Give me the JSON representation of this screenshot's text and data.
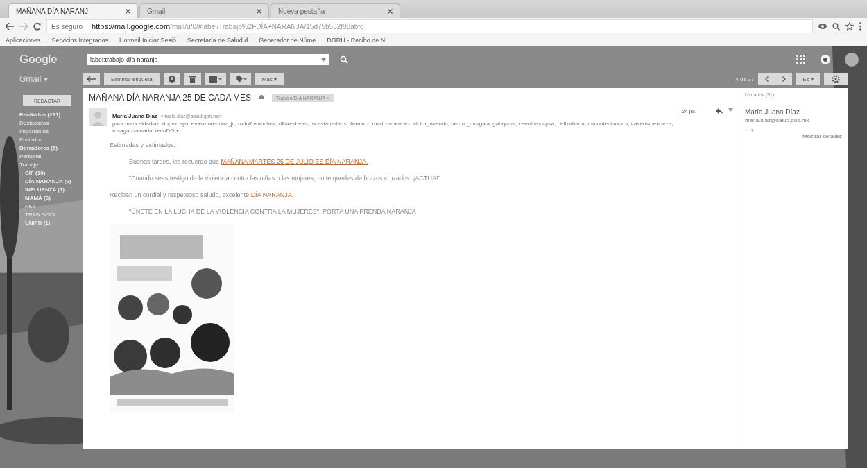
{
  "browser": {
    "tabs": [
      {
        "title": "MAÑANA DÍA NARANJ",
        "selected": true
      },
      {
        "title": "Gmail",
        "selected": false
      },
      {
        "title": "Nueva pestaña",
        "selected": false
      }
    ],
    "security": "Es seguro",
    "url_host": "https://mail.google.com",
    "url_path": "/mail/u/0/#label/Trabajo%2FDÍA+NARANJA/15d75b552f08abfc",
    "bookmarks": [
      "Aplicaciones",
      "Servicios Integrados",
      "Hotmail Iniciar Sesió",
      "Secretaría de Salud d",
      "Generador de Núme",
      "DGRH - Recibo de N"
    ]
  },
  "header": {
    "logo": "Google",
    "search": {
      "value": "label:trabajo-día-naranja"
    }
  },
  "sidebar": {
    "app": "Gmail ▾",
    "compose": "REDACTAR",
    "items": [
      {
        "label": "Recibidos (291)",
        "bold": true
      },
      {
        "label": "Destacados",
        "bold": false
      },
      {
        "label": "Importantes",
        "bold": false
      },
      {
        "label": "Enviados",
        "bold": false
      },
      {
        "label": "Borradores (5)",
        "bold": true
      },
      {
        "label": "Personal",
        "bold": false
      },
      {
        "label": "Trabajo",
        "bold": false,
        "children": [
          {
            "label": "CIF (10)",
            "bold": true
          },
          {
            "label": "DÍA NARANJA (6)",
            "bold": true
          },
          {
            "label": "INFLUENZA (1)",
            "bold": true
          },
          {
            "label": "MAMÁ (6)",
            "bold": true
          },
          {
            "label": "PKT",
            "bold": false
          },
          {
            "label": "TRAB SOCI",
            "bold": false
          },
          {
            "label": "UNIFR (1)",
            "bold": true
          }
        ]
      }
    ]
  },
  "toolbar": {
    "left": [
      {
        "kind": "icon"
      },
      {
        "kind": "text",
        "label": "Eliminar etiqueta"
      },
      {
        "kind": "icon"
      },
      {
        "kind": "icon"
      },
      {
        "kind": "icon"
      },
      {
        "kind": "icon"
      },
      {
        "kind": "text",
        "label": "Más ▾"
      }
    ],
    "count": "4 de 37",
    "lang": "Es ▾"
  },
  "message": {
    "subject": "MAÑANA DÍA NARANJA 25 DE CADA MES",
    "label_chip": "Trabajo/DÍA NARANJA ×",
    "sender": "María Juana Díaz",
    "sender_email": "<maria.diaz@salud.gob.mx>",
    "recipients": "para mariceldadiaz, rlopezbryo, evasmorendaz_jc, rodolfosanchez, dfloresbeas, mcastanedaqs, lfernadz, maritzamendez, victor_avendo, hector_morgala, gabrycoa, cenofrias.cpsa, beltzabadn, mmontecinoszur, caseosmendeza, rosagarciamarin, recoDG ▾",
    "date": "24 jul.",
    "greeting": "Estimadas y estimados:",
    "paragraphs": [
      {
        "kind": "indent",
        "parts": [
          {
            "text": "Buenas tardes, les recuerdo que ",
            "link": false
          },
          {
            "text": "MAÑANA MARTES 25 DE JULIO ES DÍA NARANJA.",
            "link": true
          }
        ]
      },
      {
        "kind": "indent",
        "parts": [
          {
            "text": "\"Cuando seas testigo de la violencia contra las niñas o las mujeres, no te quedes de brazos cruzados. ¡ACTÚA!\"",
            "link": false
          }
        ]
      },
      {
        "kind": "plain",
        "parts": [
          {
            "text": "Reciban un cordial y respetuoso saludo, excelente ",
            "link": false
          },
          {
            "text": "DÍA NARANJA.",
            "link": true
          }
        ]
      },
      {
        "kind": "indent",
        "parts": [
          {
            "text": "\"ÚNETE EN LA LUCHA DE LA VIOLENCIA CONTRA LA MUJERES\", PORTA UNA PRENDA NARANJA",
            "link": false
          }
        ]
      }
    ]
  },
  "people": {
    "title": "Usuarios (91)",
    "name": "María Juana Díaz",
    "email": "maria.diaz@salud.gob.mx",
    "more": "⋯ ▾",
    "details": "Mostrar detalles"
  }
}
